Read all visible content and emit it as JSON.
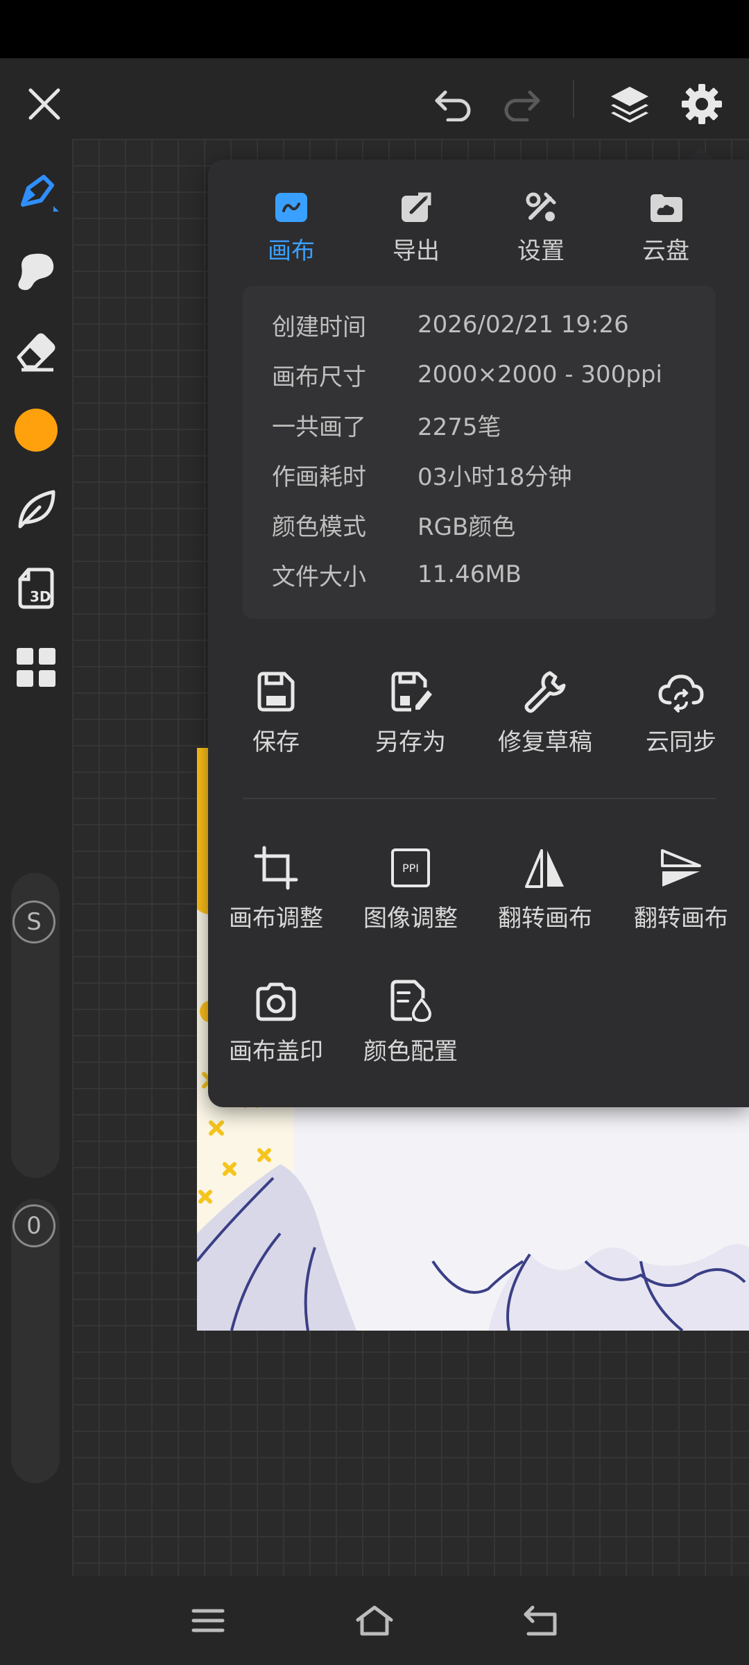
{
  "colors": {
    "accent": "#3aa0ff",
    "brush_color": "#ffa10d",
    "panel_bg": "#2d2d2f"
  },
  "toolbar": {
    "icons": [
      "close-icon",
      "undo-icon",
      "redo-icon",
      "layers-icon",
      "gear-icon"
    ]
  },
  "sidebar": {
    "tools": [
      "pen-tool-icon",
      "smudge-tool-icon",
      "eraser-icon",
      "color-swatch",
      "leaf-brush-icon",
      "3d-model-icon",
      "grid-apps-icon"
    ],
    "size_slider_label": "S",
    "opacity_slider_label": "0"
  },
  "panel": {
    "tabs": [
      {
        "label": "画布",
        "active": true
      },
      {
        "label": "导出",
        "active": false
      },
      {
        "label": "设置",
        "active": false
      },
      {
        "label": "云盘",
        "active": false
      }
    ],
    "info": [
      {
        "key": "创建时间",
        "value": "2026/02/21 19:26"
      },
      {
        "key": "画布尺寸",
        "value": "2000×2000 - 300ppi"
      },
      {
        "key": "一共画了",
        "value": "2275笔"
      },
      {
        "key": "作画耗时",
        "value": "03小时18分钟"
      },
      {
        "key": "颜色模式",
        "value": "RGB颜色"
      },
      {
        "key": "文件大小",
        "value": "11.46MB"
      }
    ],
    "actions_row1": [
      {
        "label": "保存",
        "icon": "save-icon"
      },
      {
        "label": "另存为",
        "icon": "save-as-icon"
      },
      {
        "label": "修复草稿",
        "icon": "wrench-icon"
      },
      {
        "label": "云同步",
        "icon": "cloud-sync-icon"
      }
    ],
    "actions_row2": [
      {
        "label": "画布调整",
        "icon": "crop-icon"
      },
      {
        "label": "图像调整",
        "icon": "ppi-icon",
        "icon_text": "PPI"
      },
      {
        "label": "翻转画布",
        "icon": "flip-horizontal-icon"
      },
      {
        "label": "翻转画布",
        "icon": "flip-vertical-icon"
      }
    ],
    "actions_row3": [
      {
        "label": "画布盖印",
        "icon": "camera-stamp-icon"
      },
      {
        "label": "颜色配置",
        "icon": "color-profile-icon"
      }
    ]
  },
  "navbar": {
    "icons": [
      "menu-icon",
      "home-icon",
      "back-icon"
    ]
  }
}
